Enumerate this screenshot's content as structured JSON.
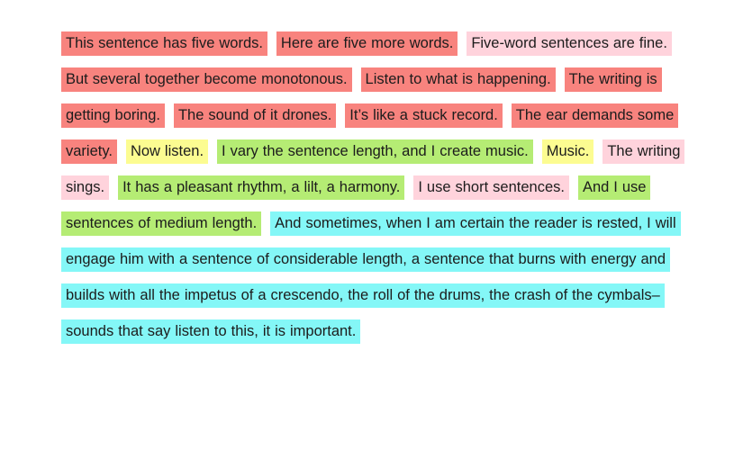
{
  "document": {
    "kind": "highlighted-prose",
    "background_color": "#ffffff",
    "text_color": "#1c1c1c",
    "palette": {
      "salmon": "#f8837e",
      "pink": "#ffd3dc",
      "yellow": "#fcfc91",
      "green": "#b5ec74",
      "cyan": "#84f7f7"
    },
    "segments": [
      {
        "text": "This sentence has five words.",
        "color": "salmon"
      },
      {
        "text": "Here are five more words.",
        "color": "salmon"
      },
      {
        "text": "Five-word sentences are fine.",
        "color": "pink"
      },
      {
        "text": "But several together become monotonous.",
        "color": "salmon"
      },
      {
        "text": "Listen to what is happening.",
        "color": "salmon"
      },
      {
        "text": "The writing is getting boring.",
        "color": "salmon"
      },
      {
        "text": "The sound of it drones.",
        "color": "salmon"
      },
      {
        "text": "It’s like a stuck record.",
        "color": "salmon"
      },
      {
        "text": "The ear demands some variety.",
        "color": "salmon"
      },
      {
        "text": "Now listen.",
        "color": "yellow"
      },
      {
        "text": "I vary the sentence length, and I create music.",
        "color": "green"
      },
      {
        "text": "Music.",
        "color": "yellow"
      },
      {
        "text": "The writing sings.",
        "color": "pink"
      },
      {
        "text": "It has a pleasant rhythm, a lilt, a harmony.",
        "color": "green"
      },
      {
        "text": "I use short sentences.",
        "color": "pink"
      },
      {
        "text": "And I use sentences of medium length.",
        "color": "green"
      },
      {
        "text": "And sometimes, when I am certain the reader is rested, I will engage him with a sentence of considerable length, a sentence that burns with energy and builds with all the impetus of a crescendo, the roll of the drums, the crash of the cymbals–sounds that say listen to this, it is important.",
        "color": "cyan"
      }
    ]
  }
}
